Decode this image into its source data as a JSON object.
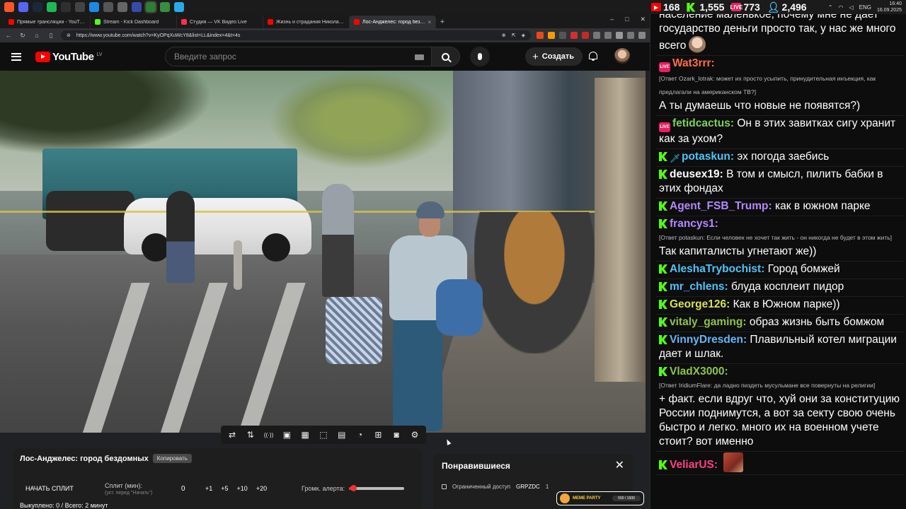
{
  "taskbar": {
    "apps": [
      {
        "icon": "brave-icon",
        "color": "#fb542b"
      },
      {
        "icon": "discord-icon",
        "color": "#5865f2"
      },
      {
        "icon": "steam-icon",
        "color": "#1b2838"
      },
      {
        "icon": "spotify-icon",
        "color": "#1db954"
      },
      {
        "icon": "obs-icon",
        "color": "#302e31"
      },
      {
        "icon": "app-x-icon",
        "color": "#444444"
      },
      {
        "icon": "app-blue-icon",
        "color": "#1e88e5"
      },
      {
        "icon": "app-checkmark-icon",
        "color": "#555555"
      },
      {
        "icon": "mail-icon",
        "color": "#666666"
      },
      {
        "icon": "app-play-icon",
        "color": "#3949ab"
      },
      {
        "icon": "kick-icon",
        "color": "#2e7d32",
        "active": true
      },
      {
        "icon": "kick-alt-icon",
        "color": "#388e3c"
      },
      {
        "icon": "telegram-icon",
        "color": "#29a9eb"
      }
    ],
    "tray": {
      "lang": "ENG",
      "time": "16:40",
      "date": "16.09.2025"
    }
  },
  "chat_stats": {
    "youtube": "168",
    "kick": "1,555",
    "vk": "773",
    "total": "2,496"
  },
  "browser": {
    "tabs": [
      {
        "label": "Прямые трансляции - YouTube Studio",
        "color": "#ff0000"
      },
      {
        "label": "Stream - Kick Dashboard",
        "color": "#53fc18"
      },
      {
        "label": "Студия — VK Видео Live",
        "color": "#ff2d55"
      },
      {
        "label": "Жизнь и страдания Николая Россов...",
        "color": "#ff0000"
      },
      {
        "label": "Лос-Анджелес: город бездом...",
        "color": "#ff0000",
        "active": true
      }
    ],
    "new_tab": "+",
    "window_controls": {
      "minimize": "–",
      "maximize": "□",
      "close": "✕"
    },
    "url": "https://www.youtube.com/watch?v=KyOPqXuWcY8&list=LL&index=4&t=4s"
  },
  "youtube": {
    "logo_text": "YouTube",
    "region": "LV",
    "search_placeholder": "Введите запрос",
    "create_label": "Создать"
  },
  "player_tools": [
    "loop-icon",
    "sort-icon",
    "broadcast-icon",
    "settings-video-icon",
    "calendar-icon",
    "frame-icon",
    "subtitles-icon",
    "speed-icon",
    "add-box-icon",
    "screenshot-icon",
    "gear-icon"
  ],
  "split_panel": {
    "title": "Лос-Анджелес: город бездомных",
    "copy_label": "Копировать",
    "start_label": "НАЧАТЬ СПЛИТ",
    "split_min_label": "Сплит (мин):",
    "split_min_hint": "(уст. перед \"Начать\")",
    "split_value": "0",
    "increments": [
      "+1",
      "+5",
      "+10",
      "+20"
    ],
    "alert_volume_label": "Громк. алерта:",
    "alert_volume": 0.08,
    "bought_text": "Выкуплено: 0 / Всего: 2 минут"
  },
  "liked_panel": {
    "title": "Понравившиеся",
    "close": "✕",
    "access": "Ограниченный доступ",
    "channel": "GRPZDC",
    "count": "1"
  },
  "meme_widget": {
    "title": "MEME PARTY",
    "progress": "550 / 1500"
  },
  "chat": [
    {
      "text": "население маленькое, почему мне не дает государство деньги просто так, у нас же много всего",
      "emote": true
    },
    {
      "badges": [
        "live"
      ],
      "user": "Wat3rrr:",
      "color": "#ff6b47",
      "reply": "[Ответ Ozark_lotrak: может их просто усыпить, принудительная инъекция, как предлагали на американском ТВ?]",
      "text": "А ты думаешь что новые не появятся?)"
    },
    {
      "badges": [
        "live"
      ],
      "user": "fetidcactus:",
      "color": "#7bd35a",
      "text": "Он в этих завитках сигу хранит как за ухом?"
    },
    {
      "badges": [
        "k",
        "sword"
      ],
      "user": "potaskun:",
      "color": "#4fc3f7",
      "text": "эх погода заебись"
    },
    {
      "badges": [
        "k"
      ],
      "user": "deusex19:",
      "color": "#ffffff",
      "text": "В том и смысл, пилить бабки в этих фондах"
    },
    {
      "badges": [
        "k"
      ],
      "user": "Agent_FSB_Trump:",
      "color": "#b388ff",
      "text": "как в южном парке"
    },
    {
      "badges": [
        "k"
      ],
      "user": "francys1:",
      "color": "#b388ff",
      "reply": "[Ответ potaskun: Если человек не хочет так жить - он никогда не будет в этом жить]",
      "text": "Так капиталисты угнетают же))"
    },
    {
      "badges": [
        "k"
      ],
      "user": "AleshaTrybochist:",
      "color": "#4fc3f7",
      "text": "Город бомжей"
    },
    {
      "badges": [
        "k"
      ],
      "user": "mr_chlens:",
      "color": "#4fc3f7",
      "text": "блуда косплеит пидор"
    },
    {
      "badges": [
        "k"
      ],
      "user": "George126:",
      "color": "#d4e157",
      "text": "Как в Южном парке))"
    },
    {
      "badges": [
        "k"
      ],
      "user": "vitaly_gaming:",
      "color": "#8bc34a",
      "text": "образ жизнь быть бомжом"
    },
    {
      "badges": [
        "k"
      ],
      "user": "VinnyDresden:",
      "color": "#64b5f6",
      "text": "Плавильный котел миграции дает и шлак."
    },
    {
      "badges": [
        "k"
      ],
      "user": "VladX3000:",
      "color": "#8bc34a",
      "reply": "[Ответ IridiumFlare: да ладно пиздеть мусульмане все повернуты на религии]",
      "text": "+ факт. если вдруг что, хуй они за конституцию России поднимутся, а вот за секту свою очень быстро и легко. много их на военном учете стоит? вот именно"
    },
    {
      "badges": [
        "k"
      ],
      "user": "VeliarUS:",
      "color": "#ff4081",
      "text": "",
      "emote_sq": true
    }
  ]
}
